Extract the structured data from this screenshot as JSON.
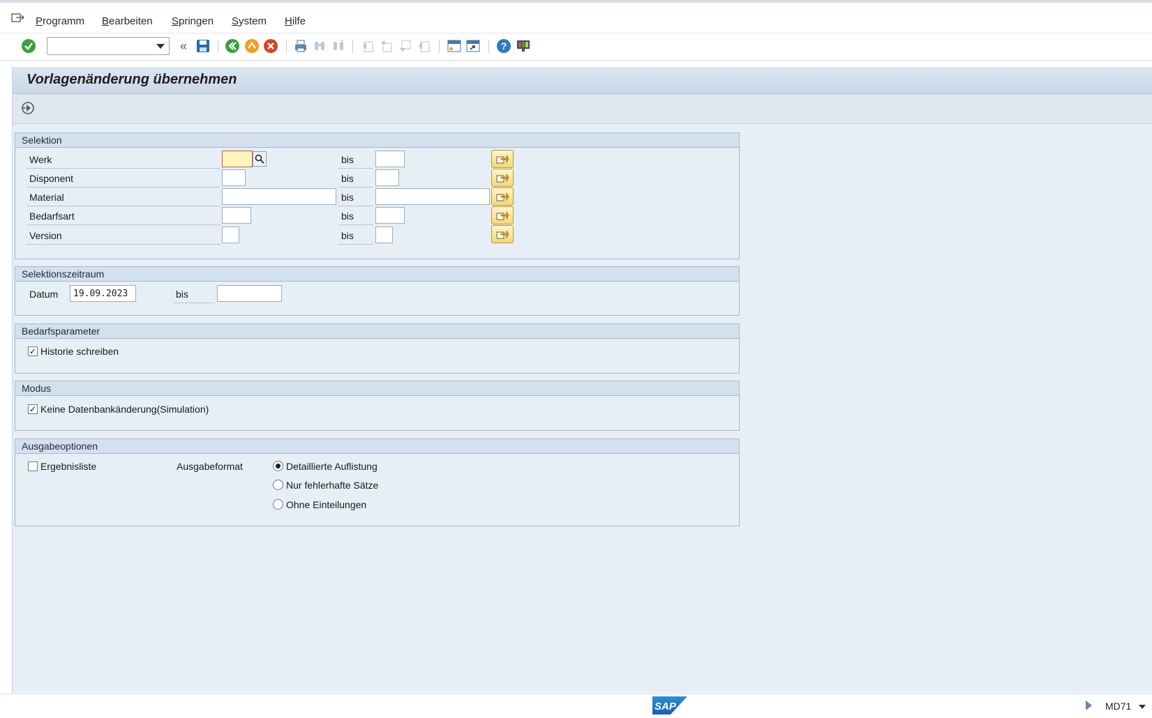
{
  "menu": {
    "items": [
      {
        "pre": "",
        "ul": "P",
        "post": "rogramm"
      },
      {
        "pre": "",
        "ul": "B",
        "post": "earbeiten"
      },
      {
        "pre": "",
        "ul": "S",
        "post": "pringen"
      },
      {
        "pre": "",
        "ul": "S",
        "post": "ystem"
      },
      {
        "pre": "",
        "ul": "H",
        "post": "ilfe"
      }
    ]
  },
  "toolbar": {
    "command_value": "",
    "icons": [
      "enter-icon",
      "command-field",
      "back-arrows-icon",
      "save-icon",
      "back-icon",
      "exit-icon",
      "cancel-icon",
      "print-icon",
      "find-icon",
      "find-next-icon",
      "first-page-icon",
      "previous-page-icon",
      "next-page-icon",
      "last-page-icon",
      "create-session-icon",
      "shortcut-icon",
      "help-icon",
      "customize-layout-icon"
    ]
  },
  "title": "Vorlagenänderung übernehmen",
  "apptoolbar": {
    "execute_icon": "execute-icon"
  },
  "selektion": {
    "header": "Selektion",
    "rows": [
      {
        "label": "Werk",
        "from": "",
        "to": "",
        "bis": "bis"
      },
      {
        "label": "Disponent",
        "from": "",
        "to": "",
        "bis": "bis"
      },
      {
        "label": "Material",
        "from": "",
        "to": "",
        "bis": "bis"
      },
      {
        "label": "Bedarfsart",
        "from": "",
        "to": "",
        "bis": "bis"
      },
      {
        "label": "Version",
        "from": "",
        "to": "",
        "bis": "bis"
      }
    ]
  },
  "zeitraum": {
    "header": "Selektionszeitraum",
    "datum_label": "Datum",
    "datum_from": "19.09.2023",
    "bis_label": "bis",
    "datum_to": ""
  },
  "bedarf": {
    "header": "Bedarfsparameter",
    "historie_label": "Historie schreiben",
    "historie_checked": true
  },
  "modus": {
    "header": "Modus",
    "simulation_label": "Keine Datenbankänderung(Simulation)",
    "simulation_checked": true
  },
  "ausgabe": {
    "header": "Ausgabeoptionen",
    "ergebnis_label": "Ergebnisliste",
    "ergebnis_checked": false,
    "format_label": "Ausgabeformat",
    "options": [
      "Detaillierte Auflistung",
      "Nur fehlerhafte Sätze",
      "Ohne Einteilungen"
    ],
    "selected": "Detaillierte Auflistung"
  },
  "status": {
    "logo": "SAP",
    "tcode": "MD71"
  }
}
